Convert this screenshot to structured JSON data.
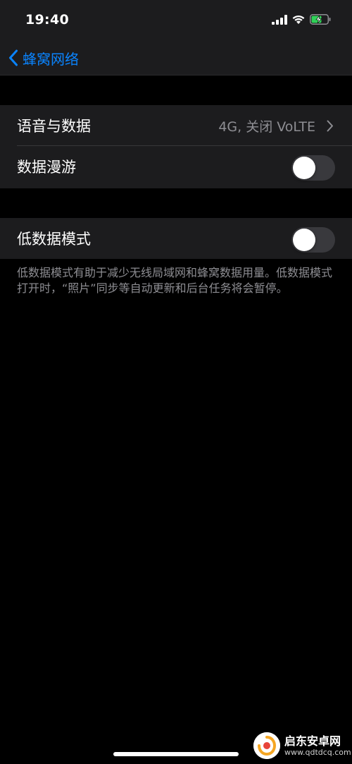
{
  "status_bar": {
    "time": "19:40"
  },
  "nav": {
    "back_label": "蜂窝网络"
  },
  "settings": {
    "voice_data": {
      "label": "语音与数据",
      "value": "4G, 关闭 VoLTE"
    },
    "data_roaming": {
      "label": "数据漫游",
      "enabled": false
    },
    "low_data_mode": {
      "label": "低数据模式",
      "enabled": false
    },
    "footer_note": "低数据模式有助于减少无线局域网和蜂窝数据用量。低数据模式打开时，“照片”同步等自动更新和后台任务将会暂停。"
  },
  "watermark": {
    "title": "启东安卓网",
    "url": "www.qdtdcq.com"
  },
  "colors": {
    "background": "#000000",
    "group_bg": "#1c1c1e",
    "accent": "#0a84ff",
    "secondary_text": "#8e8e93",
    "toggle_off": "#39393d",
    "battery_charge": "#30d158"
  },
  "icons": {
    "back": "chevron-left-icon",
    "disclosure": "chevron-right-icon",
    "signal": "cellular-signal-icon",
    "wifi": "wifi-icon",
    "battery": "battery-charging-icon"
  }
}
